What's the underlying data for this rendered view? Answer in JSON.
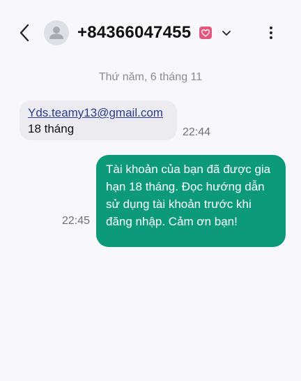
{
  "header": {
    "back_icon": "chevron-left-icon",
    "avatar_icon": "person-icon",
    "contact_number": "+84366047455",
    "badge_icon": "heart-icon",
    "expand_icon": "chevron-down-icon",
    "more_icon": "more-vertical-icon"
  },
  "conversation": {
    "date_separator": "Thứ năm, 6 tháng 11",
    "messages": [
      {
        "direction": "incoming",
        "link": "Yds.teamy13@gmail.com",
        "text": "18 tháng",
        "time": "22:44"
      },
      {
        "direction": "outgoing",
        "text": "Tài khoản của bạn đã được gia hạn 18 tháng. Đọc hướng dẫn sử dụng tài khoản trước khi đăng nhập. Cảm ơn bạn!",
        "time": "22:45"
      }
    ]
  },
  "colors": {
    "background": "#f8f8fc",
    "incoming_bubble": "#ebebf0",
    "outgoing_bubble": "#0d9a7a",
    "link": "#2a3d8f",
    "badge": "#e4577c"
  }
}
